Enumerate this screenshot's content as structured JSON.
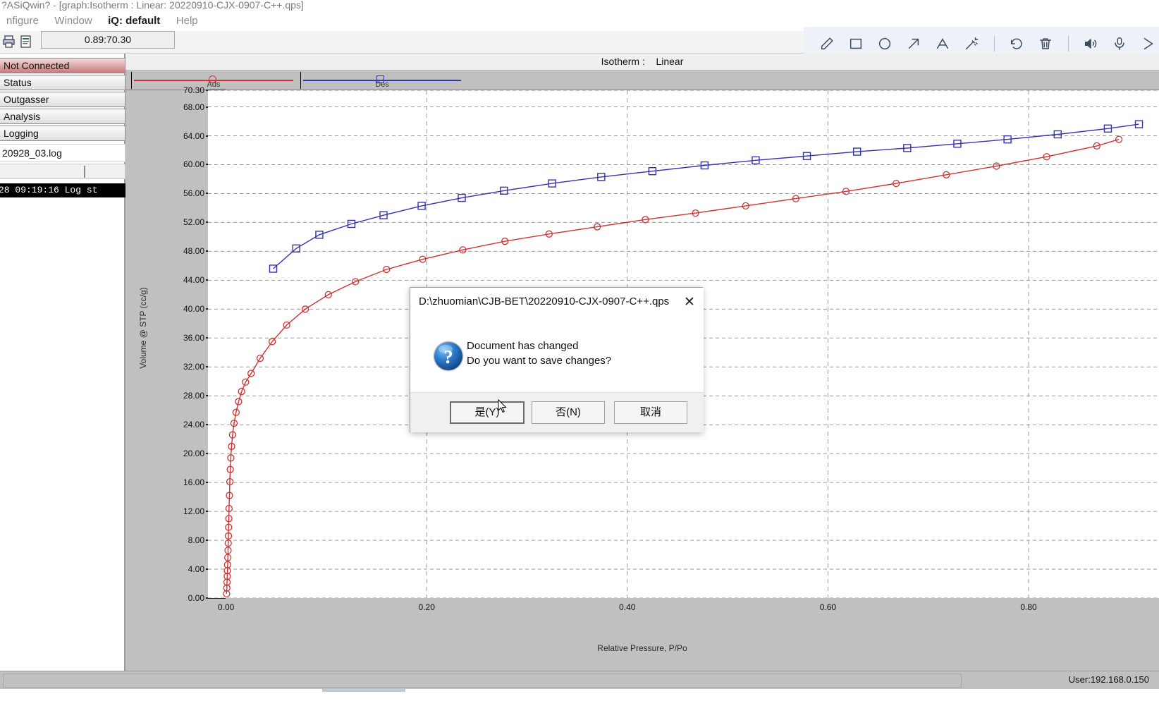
{
  "window": {
    "title": "?ASiQwin? - [graph:Isotherm :   Linear: 20220910-CJX-0907-C++.qps]"
  },
  "menubar": {
    "items": [
      {
        "label": "nfigure",
        "strong": false
      },
      {
        "label": "Window",
        "strong": false
      },
      {
        "label": "iQ: default",
        "strong": true
      },
      {
        "label": "Help",
        "strong": false
      }
    ]
  },
  "toolstrip": {
    "icons": [
      "print-icon",
      "report-icon"
    ],
    "coordinate_value": "0.89:70.30"
  },
  "annotation_toolbar": {
    "tools": [
      {
        "name": "pen-icon",
        "label": "Pen"
      },
      {
        "name": "rectangle-icon",
        "label": "Rectangle"
      },
      {
        "name": "ellipse-icon",
        "label": "Ellipse"
      },
      {
        "name": "arrow-icon",
        "label": "Arrow"
      },
      {
        "name": "text-icon",
        "label": "Text"
      },
      {
        "name": "magic-wand-icon",
        "label": "Highlight"
      },
      {
        "name": "undo-icon",
        "label": "Undo"
      },
      {
        "name": "trash-icon",
        "label": "Delete"
      },
      {
        "name": "speaker-icon",
        "label": "Speaker"
      },
      {
        "name": "microphone-icon",
        "label": "Microphone"
      },
      {
        "name": "close-icon",
        "label": "Close"
      }
    ]
  },
  "sidebar": {
    "items": [
      {
        "label": "Not Connected",
        "state": "alert"
      },
      {
        "label": "Status",
        "state": "normal"
      },
      {
        "label": "Outgasser",
        "state": "normal"
      },
      {
        "label": "Analysis",
        "state": "normal"
      },
      {
        "label": "Logging",
        "state": "normal"
      }
    ],
    "logfile": "20928_03.log",
    "terminal_line": "28 09:19:16   Log st"
  },
  "graph_window": {
    "header_label": "Isotherm :",
    "header_value": "Linear"
  },
  "statusbar": {
    "user": "User:192.168.0.150"
  },
  "dialog": {
    "title": "D:\\zhuomian\\CJB-BET\\20220910-CJX-0907-C++.qps",
    "close_label": "✕",
    "icon": "question-icon",
    "message_line1": "Document has changed",
    "message_line2": "Do you want to save changes?",
    "buttons": [
      {
        "label": "是(Y)",
        "default": true
      },
      {
        "label": "否(N)",
        "default": false
      },
      {
        "label": "取消",
        "default": false
      }
    ]
  },
  "chart_data": {
    "type": "line",
    "title": "Isotherm : Linear",
    "xlabel": "Relative Pressure, P/Po",
    "ylabel": "Volume @ STP (cc/g)",
    "xlim": [
      -0.018,
      0.93
    ],
    "ylim": [
      0.0,
      70.3
    ],
    "xticks": [
      "0.00",
      "0.20",
      "0.40",
      "0.60",
      "0.80"
    ],
    "xtickvals": [
      0.0,
      0.2,
      0.4,
      0.6,
      0.8
    ],
    "yticks": [
      "70.30",
      "68.00",
      "64.00",
      "60.00",
      "56.00",
      "52.00",
      "48.00",
      "44.00",
      "40.00",
      "36.00",
      "32.00",
      "28.00",
      "24.00",
      "20.00",
      "16.00",
      "12.00",
      "8.00",
      "4.00",
      "0.00"
    ],
    "ytickvals": [
      70.3,
      68.0,
      64.0,
      60.0,
      56.0,
      52.0,
      48.0,
      44.0,
      40.0,
      36.0,
      32.0,
      28.0,
      24.0,
      20.0,
      16.0,
      12.0,
      8.0,
      4.0,
      0.0
    ],
    "grid": true,
    "legend_position": "top",
    "series": [
      {
        "name": "Ads",
        "color": "#cc3333",
        "marker": "circle",
        "points": [
          [
            0.0005,
            0.6
          ],
          [
            0.0008,
            1.4
          ],
          [
            0.001,
            2.2
          ],
          [
            0.0012,
            3.0
          ],
          [
            0.0014,
            3.8
          ],
          [
            0.0016,
            4.6
          ],
          [
            0.0018,
            5.6
          ],
          [
            0.002,
            6.6
          ],
          [
            0.0022,
            7.6
          ],
          [
            0.0024,
            8.6
          ],
          [
            0.0026,
            9.8
          ],
          [
            0.0028,
            11.0
          ],
          [
            0.003,
            12.4
          ],
          [
            0.0034,
            14.2
          ],
          [
            0.0038,
            16.1
          ],
          [
            0.0042,
            17.8
          ],
          [
            0.0048,
            19.4
          ],
          [
            0.0055,
            21.0
          ],
          [
            0.0065,
            22.6
          ],
          [
            0.008,
            24.2
          ],
          [
            0.01,
            25.7
          ],
          [
            0.0125,
            27.2
          ],
          [
            0.0155,
            28.6
          ],
          [
            0.0195,
            29.9
          ],
          [
            0.025,
            31.1
          ],
          [
            0.034,
            33.2
          ],
          [
            0.046,
            35.5
          ],
          [
            0.0605,
            37.8
          ],
          [
            0.079,
            40.0
          ],
          [
            0.102,
            42.0
          ],
          [
            0.129,
            43.8
          ],
          [
            0.16,
            45.5
          ],
          [
            0.196,
            46.9
          ],
          [
            0.236,
            48.2
          ],
          [
            0.278,
            49.4
          ],
          [
            0.322,
            50.4
          ],
          [
            0.37,
            51.4
          ],
          [
            0.418,
            52.4
          ],
          [
            0.468,
            53.3
          ],
          [
            0.518,
            54.3
          ],
          [
            0.568,
            55.3
          ],
          [
            0.618,
            56.3
          ],
          [
            0.668,
            57.4
          ],
          [
            0.718,
            58.6
          ],
          [
            0.768,
            59.8
          ],
          [
            0.818,
            61.1
          ],
          [
            0.868,
            62.6
          ],
          [
            0.89,
            63.5
          ]
        ]
      },
      {
        "name": "Des",
        "color": "#3333aa",
        "marker": "square",
        "points": [
          [
            0.047,
            45.6
          ],
          [
            0.07,
            48.4
          ],
          [
            0.093,
            50.3
          ],
          [
            0.125,
            51.8
          ],
          [
            0.157,
            53.0
          ],
          [
            0.195,
            54.3
          ],
          [
            0.235,
            55.4
          ],
          [
            0.277,
            56.4
          ],
          [
            0.325,
            57.4
          ],
          [
            0.374,
            58.3
          ],
          [
            0.425,
            59.1
          ],
          [
            0.477,
            59.9
          ],
          [
            0.528,
            60.6
          ],
          [
            0.579,
            61.2
          ],
          [
            0.629,
            61.8
          ],
          [
            0.679,
            62.3
          ],
          [
            0.729,
            62.9
          ],
          [
            0.779,
            63.5
          ],
          [
            0.829,
            64.2
          ],
          [
            0.879,
            65.0
          ],
          [
            0.91,
            65.6
          ]
        ]
      }
    ]
  }
}
